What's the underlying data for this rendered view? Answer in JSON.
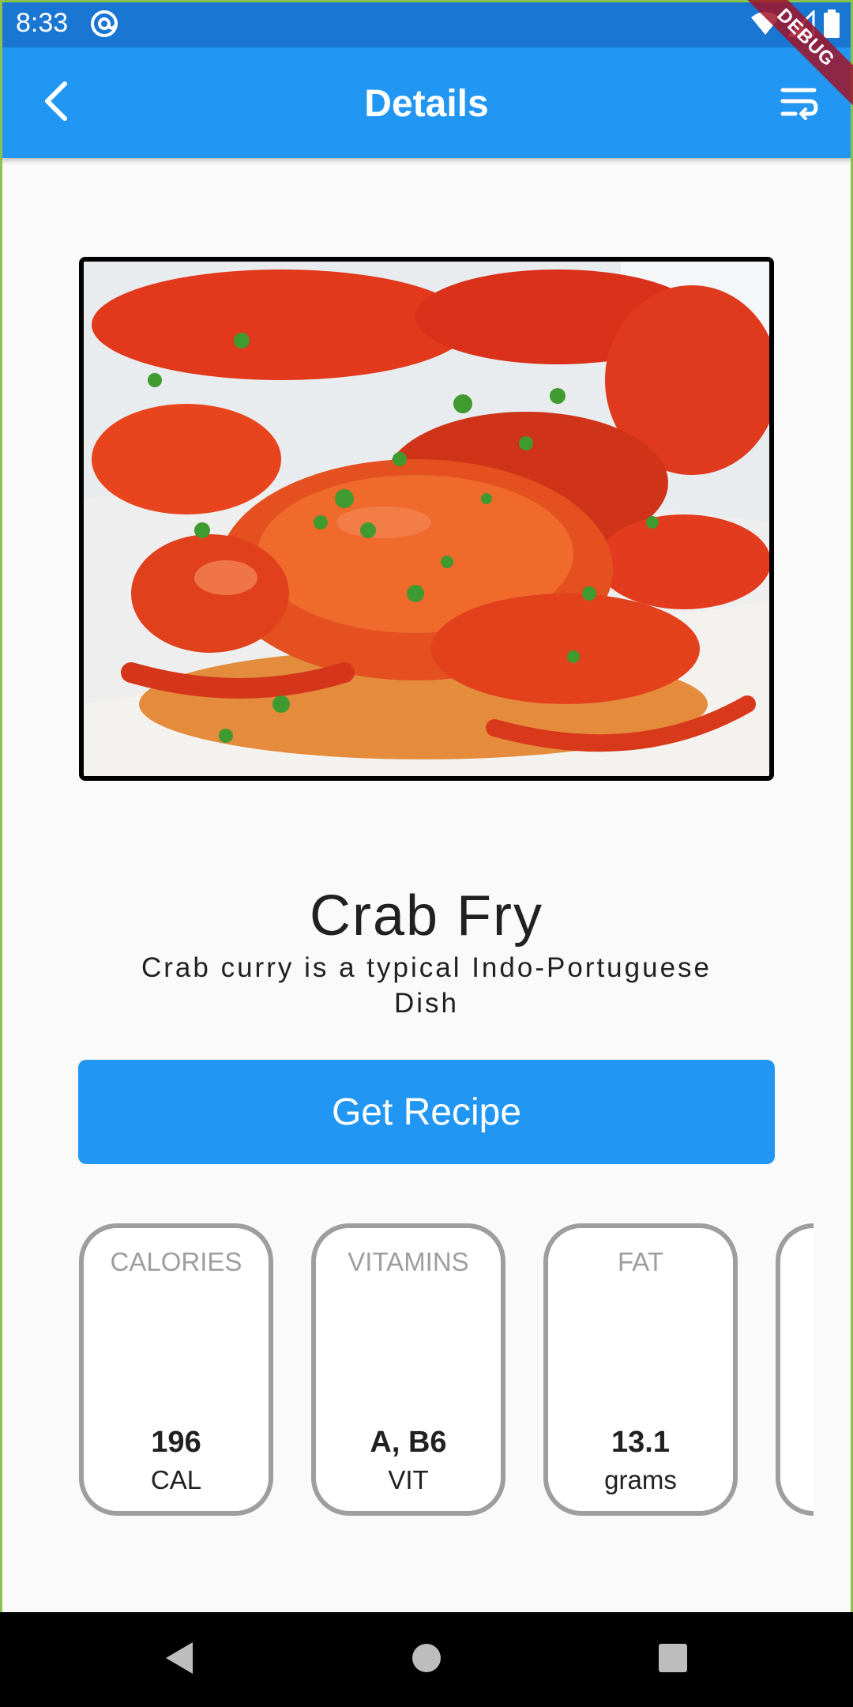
{
  "status_bar": {
    "time": "8:33",
    "app_icon": "at-sign-icon",
    "icons": [
      "wifi-icon",
      "signal-icon",
      "battery-icon"
    ]
  },
  "app_bar": {
    "title": "Details",
    "back_icon": "chevron-left-icon",
    "action_icon": "text-wrap-icon",
    "background": "#2196f3"
  },
  "debug_banner": "DEBUG",
  "dish": {
    "image": "crab-fry-photo",
    "title": "Crab Fry",
    "subtitle": "Crab curry is a typical Indo-Portuguese Dish"
  },
  "actions": {
    "get_recipe_label": "Get Recipe",
    "button_color": "#2196f3"
  },
  "nutrition": [
    {
      "label": "CALORIES",
      "value": "196",
      "unit": "CAL"
    },
    {
      "label": "VITAMINS",
      "value": "A, B6",
      "unit": "VIT"
    },
    {
      "label": "FAT",
      "value": "13.1",
      "unit": "grams"
    },
    {
      "label": "",
      "value": "",
      "unit": ""
    }
  ],
  "nav": {
    "back_icon": "triangle-back-icon",
    "home_icon": "circle-home-icon",
    "recents_icon": "square-recents-icon"
  }
}
